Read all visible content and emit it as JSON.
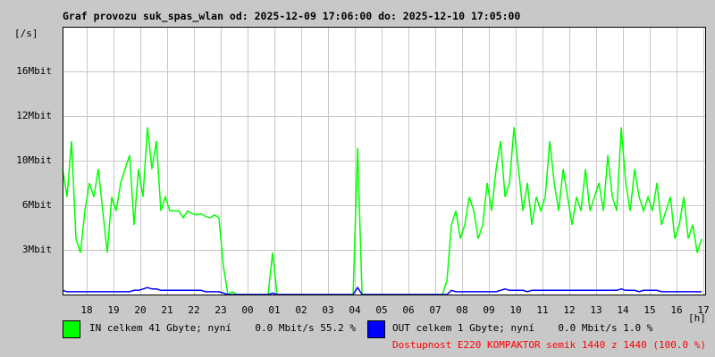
{
  "chart_data": {
    "type": "line",
    "title": "Graf provozu suk_spas_wlan od: 2025-12-09 17:06:00 do: 2025-12-10 17:05:00",
    "ylabel": "[/s]",
    "xlabel": "[h]",
    "ylim": [
      0,
      19.2
    ],
    "y_ticks": [
      {
        "value": 3.2,
        "label": "3Mbit"
      },
      {
        "value": 6.4,
        "label": "6Mbit"
      },
      {
        "value": 9.6,
        "label": "10Mbit"
      },
      {
        "value": 12.8,
        "label": "12Mbit"
      },
      {
        "value": 16,
        "label": "16Mbit"
      }
    ],
    "x_start_hour": 17.1,
    "x_step_hours": 0.1667,
    "x_ticks": [
      "18",
      "19",
      "20",
      "21",
      "22",
      "23",
      "00",
      "01",
      "02",
      "03",
      "04",
      "05",
      "06",
      "07",
      "08",
      "09",
      "10",
      "11",
      "12",
      "13",
      "14",
      "15",
      "16",
      "17"
    ],
    "grid": true,
    "series": [
      {
        "name": "IN",
        "color": "#00ff00",
        "unit": "Mbit/s",
        "values": [
          9,
          7,
          11,
          4,
          3,
          6,
          8,
          7,
          9,
          6,
          3,
          7,
          6,
          8,
          9,
          10,
          5,
          9,
          7,
          12,
          9,
          11,
          6,
          7,
          6,
          6,
          6,
          5.5,
          6,
          5.8,
          5.7,
          5.8,
          5.6,
          5.5,
          5.7,
          5.5,
          2,
          0,
          0.2,
          0,
          0,
          0,
          0,
          0,
          0,
          0,
          0,
          3,
          0,
          0,
          0,
          0,
          0,
          0,
          0,
          0,
          0,
          0,
          0,
          0,
          0,
          0,
          0,
          0,
          0,
          0,
          10.5,
          0,
          0,
          0,
          0,
          0,
          0,
          0,
          0,
          0,
          0,
          0,
          0,
          0,
          0,
          0,
          0,
          0,
          0,
          0,
          1,
          5,
          6,
          4,
          5,
          7,
          6,
          4,
          5,
          8,
          6,
          9,
          11,
          7,
          8,
          12,
          9,
          6,
          8,
          5,
          7,
          6,
          7,
          11,
          8,
          6,
          9,
          7,
          5,
          7,
          6,
          9,
          6,
          7,
          8,
          6,
          10,
          7,
          6,
          12,
          8,
          6,
          9,
          7,
          6,
          7,
          6,
          8,
          5,
          6,
          7,
          4,
          5,
          7,
          4,
          5,
          3,
          4
        ]
      },
      {
        "name": "OUT",
        "color": "#0000ff",
        "unit": "Mbit/s",
        "values": [
          0.3,
          0.2,
          0.2,
          0.2,
          0.2,
          0.2,
          0.2,
          0.2,
          0.2,
          0.2,
          0.2,
          0.2,
          0.2,
          0.2,
          0.2,
          0.2,
          0.3,
          0.3,
          0.4,
          0.5,
          0.4,
          0.4,
          0.3,
          0.3,
          0.3,
          0.3,
          0.3,
          0.3,
          0.3,
          0.3,
          0.3,
          0.3,
          0.2,
          0.2,
          0.2,
          0.2,
          0.1,
          0,
          0,
          0,
          0,
          0,
          0,
          0,
          0,
          0,
          0,
          0.1,
          0,
          0,
          0,
          0,
          0,
          0,
          0,
          0,
          0,
          0,
          0,
          0,
          0,
          0,
          0,
          0,
          0,
          0,
          0.5,
          0,
          0,
          0,
          0,
          0,
          0,
          0,
          0,
          0,
          0,
          0,
          0,
          0,
          0,
          0,
          0,
          0,
          0,
          0,
          0,
          0.3,
          0.2,
          0.2,
          0.2,
          0.2,
          0.2,
          0.2,
          0.2,
          0.2,
          0.2,
          0.2,
          0.3,
          0.4,
          0.3,
          0.3,
          0.3,
          0.3,
          0.2,
          0.3,
          0.3,
          0.3,
          0.3,
          0.3,
          0.3,
          0.3,
          0.3,
          0.3,
          0.3,
          0.3,
          0.3,
          0.3,
          0.3,
          0.3,
          0.3,
          0.3,
          0.3,
          0.3,
          0.3,
          0.4,
          0.3,
          0.3,
          0.3,
          0.2,
          0.3,
          0.3,
          0.3,
          0.3,
          0.2,
          0.2,
          0.2,
          0.2,
          0.2,
          0.2,
          0.2,
          0.2,
          0.2,
          0.2
        ]
      }
    ],
    "legend": {
      "in_text": "IN celkem 41 Gbyte; nyní    0.0 Mbit/s 55.2 %",
      "out_text": "OUT celkem 1 Gbyte; nyní    0.0 Mbit/s 1.0 %",
      "availability": "Dostupnost E220 KOMPAKTOR semik 1440 z 1440 (100.0 %)"
    }
  }
}
